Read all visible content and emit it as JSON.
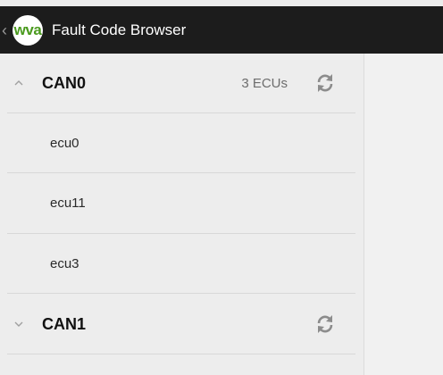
{
  "titlebar": {
    "logo_text": "wva",
    "title": "Fault Code Browser"
  },
  "buses": [
    {
      "name": "CAN0",
      "expanded": true,
      "ecu_count": "3 ECUs",
      "ecus": [
        {
          "name": "ecu0"
        },
        {
          "name": "ecu11"
        },
        {
          "name": "ecu3"
        }
      ]
    },
    {
      "name": "CAN1",
      "expanded": false,
      "ecu_count": "",
      "ecus": []
    }
  ],
  "colors": {
    "titlebar_bg": "#1c1c1c",
    "logo_green": "#4a9a1e",
    "list_bg": "#ededed"
  },
  "icons": {
    "back": "chevron-left-icon",
    "expanded": "chevron-up-icon",
    "collapsed": "chevron-down-icon",
    "refresh": "refresh-icon"
  }
}
